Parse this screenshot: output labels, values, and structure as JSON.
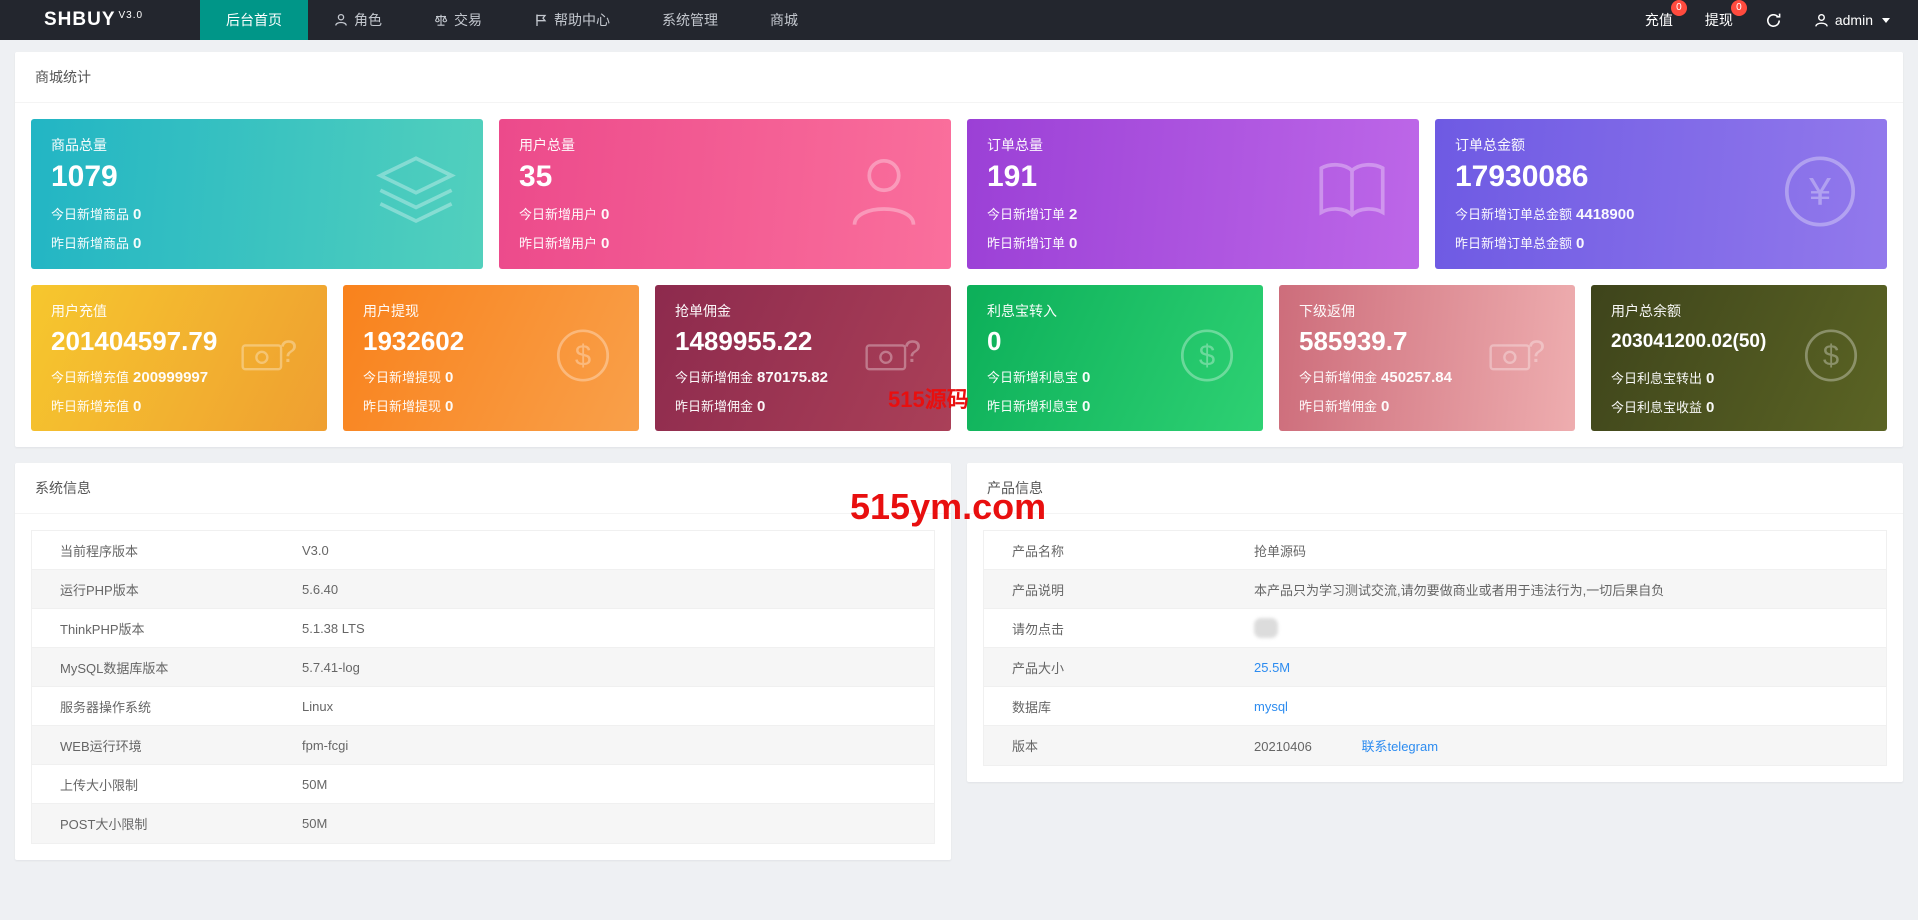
{
  "colors": {
    "navbar_bg": "#23262e",
    "active_nav_bg": "#009688",
    "badge_red": "#ff4b3e",
    "link_blue": "#2d8cf0",
    "watermark_red": "#e80f0f"
  },
  "navbar": {
    "logo": "SHBUY",
    "version": "V3.0",
    "items": [
      {
        "label": "后台首页",
        "icon": null,
        "active": true
      },
      {
        "label": "角色",
        "icon": "user-icon",
        "active": false
      },
      {
        "label": "交易",
        "icon": "scale-icon",
        "active": false
      },
      {
        "label": "帮助中心",
        "icon": "flag-icon",
        "active": false
      },
      {
        "label": "系统管理",
        "icon": null,
        "active": false
      },
      {
        "label": "商城",
        "icon": null,
        "active": false
      }
    ],
    "recharge_label": "充值",
    "recharge_badge": "0",
    "withdraw_label": "提现",
    "withdraw_badge": "0",
    "refresh_icon": "refresh-icon",
    "username": "admin"
  },
  "stats": {
    "title": "商城统计",
    "row1": [
      {
        "title": "商品总量",
        "value": "1079",
        "today_label": "今日新增商品",
        "today_value": "0",
        "yesterday_label": "昨日新增商品",
        "yesterday_value": "0",
        "icon": "layers-icon",
        "gradient": [
          "#22b5c4",
          "#52d0bd"
        ]
      },
      {
        "title": "用户总量",
        "value": "35",
        "today_label": "今日新增用户",
        "today_value": "0",
        "yesterday_label": "昨日新增用户",
        "yesterday_value": "0",
        "icon": "user-icon",
        "gradient": [
          "#ec4a8b",
          "#fa6f9c"
        ]
      },
      {
        "title": "订单总量",
        "value": "191",
        "today_label": "今日新增订单",
        "today_value": "2",
        "yesterday_label": "昨日新增订单",
        "yesterday_value": "0",
        "icon": "book-icon",
        "gradient": [
          "#9b40d6",
          "#bd67e8"
        ]
      },
      {
        "title": "订单总金额",
        "value": "17930086",
        "today_label": "今日新增订单总金额",
        "today_value": "4418900",
        "yesterday_label": "昨日新增订单总金额",
        "yesterday_value": "0",
        "icon": "yen-circle-icon",
        "gradient": [
          "#6e5ae3",
          "#9279ec"
        ]
      }
    ],
    "row2": [
      {
        "title": "用户充值",
        "value": "201404597.79",
        "today_label": "今日新增充值",
        "today_value": "200999997",
        "yesterday_label": "昨日新增充值",
        "yesterday_value": "0",
        "icon": "bill-question-icon",
        "gradient": [
          "#f6c72e",
          "#ef9f31"
        ]
      },
      {
        "title": "用户提现",
        "value": "1932602",
        "today_label": "今日新增提现",
        "today_value": "0",
        "yesterday_label": "昨日新增提现",
        "yesterday_value": "0",
        "icon": "dollar-circle-icon",
        "gradient": [
          "#f9821c",
          "#f9a04a"
        ]
      },
      {
        "title": "抢单佣金",
        "value": "1489955.22",
        "today_label": "今日新增佣金",
        "today_value": "870175.82",
        "yesterday_label": "昨日新增佣金",
        "yesterday_value": "0",
        "icon": "bill-question-icon",
        "gradient": [
          "#8d2a4d",
          "#aa4058"
        ]
      },
      {
        "title": "利息宝转入",
        "value": "0",
        "today_label": "今日新增利息宝",
        "today_value": "0",
        "yesterday_label": "昨日新增利息宝",
        "yesterday_value": "0",
        "icon": "dollar-circle-icon",
        "gradient": [
          "#0caf59",
          "#2ed173"
        ]
      },
      {
        "title": "下级返佣",
        "value": "585939.7",
        "today_label": "今日新增佣金",
        "today_value": "450257.84",
        "yesterday_label": "昨日新增佣金",
        "yesterday_value": "0",
        "icon": "bill-question-icon",
        "gradient": [
          "#cd6d7b",
          "#eeadaf"
        ]
      },
      {
        "title": "用户总余额",
        "value": "203041200.02(50)",
        "today_label": "今日利息宝转出",
        "today_value": "0",
        "yesterday_label": "今日利息宝收益",
        "yesterday_value": "0",
        "icon": "dollar-circle-icon",
        "gradient": [
          "#3e441b",
          "#5b6424"
        ]
      }
    ]
  },
  "system_info": {
    "title": "系统信息",
    "rows": [
      {
        "label": "当前程序版本",
        "value": "V3.0"
      },
      {
        "label": "运行PHP版本",
        "value": "5.6.40"
      },
      {
        "label": "ThinkPHP版本",
        "value": "5.1.38 LTS"
      },
      {
        "label": "MySQL数据库版本",
        "value": "5.7.41-log"
      },
      {
        "label": "服务器操作系统",
        "value": "Linux"
      },
      {
        "label": "WEB运行环境",
        "value": "fpm-fcgi"
      },
      {
        "label": "上传大小限制",
        "value": "50M"
      },
      {
        "label": "POST大小限制",
        "value": "50M"
      }
    ]
  },
  "product_info": {
    "title": "产品信息",
    "rows": [
      {
        "label": "产品名称",
        "value": "抢单源码"
      },
      {
        "label": "产品说明",
        "value": "本产品只为学习测试交流,请勿要做商业或者用于违法行为,一切后果自负"
      },
      {
        "label": "请勿点击",
        "value": "",
        "icon": "blurred-icon"
      },
      {
        "label": "产品大小",
        "value": "25.5M",
        "link": true
      },
      {
        "label": "数据库",
        "value": "mysql",
        "link": true
      },
      {
        "label": "版本",
        "value": "20210406",
        "extra_link": "联系telegram"
      }
    ]
  },
  "watermarks": {
    "line1": "515源码",
    "line2": "515ym.com"
  }
}
